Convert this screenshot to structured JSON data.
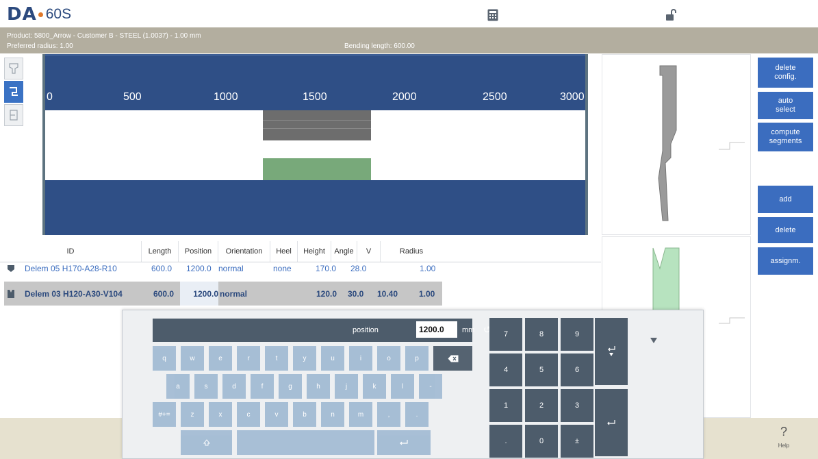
{
  "header": {
    "logo_brand": "DA",
    "logo_model": "60S",
    "icons": [
      "calculator-icon",
      "unlock-icon"
    ]
  },
  "product_bar": {
    "line1": "Product: 5800_Arrow - Customer B - STEEL (1.0037) - 1.00 mm",
    "line2": "Preferred radius: 1.00",
    "bending_length": "Bending length: 600.00"
  },
  "ruler": [
    "0",
    "500",
    "1000",
    "1500",
    "2000",
    "2500",
    "3000"
  ],
  "actions": {
    "delete_config_1": "delete",
    "delete_config_2": "config.",
    "auto_select_1": "auto",
    "auto_select_2": "select",
    "compute_1": "compute",
    "compute_2": "segments",
    "add": "add",
    "delete": "delete",
    "assign": "assignm."
  },
  "table": {
    "headers": [
      "ID",
      "Length",
      "Position",
      "Orientation",
      "Heel",
      "Height",
      "Angle",
      "V",
      "Radius"
    ],
    "rows": [
      {
        "id": "Delem 05 H170-A28-R10",
        "length": "600.0",
        "position": "1200.0",
        "orientation": "normal",
        "heel": "none",
        "height": "170.0",
        "angle": "28.0",
        "v": "",
        "radius": "1.00"
      },
      {
        "id": "Delem 03 H120-A30-V104",
        "length": "600.0",
        "position": "1200.0",
        "orientation": "normal",
        "heel": "",
        "height": "120.0",
        "angle": "30.0",
        "v": "10.40",
        "radius": "1.00"
      }
    ]
  },
  "keyboard": {
    "field_label": "position",
    "field_value": "1200.0",
    "unit": "mm",
    "row1": [
      "q",
      "w",
      "e",
      "r",
      "t",
      "y",
      "u",
      "i",
      "o",
      "p"
    ],
    "row2": [
      "a",
      "s",
      "d",
      "f",
      "g",
      "h",
      "j",
      "k",
      "l",
      "-"
    ],
    "row3": [
      "#+=",
      "z",
      "x",
      "c",
      "v",
      "b",
      "n",
      "m",
      ",",
      "."
    ],
    "numpad": [
      "7",
      "8",
      "9",
      "4",
      "5",
      "6",
      "1",
      "2",
      "3",
      ".",
      "0",
      "±"
    ]
  },
  "help": {
    "label": "Help",
    "glyph": "?"
  }
}
